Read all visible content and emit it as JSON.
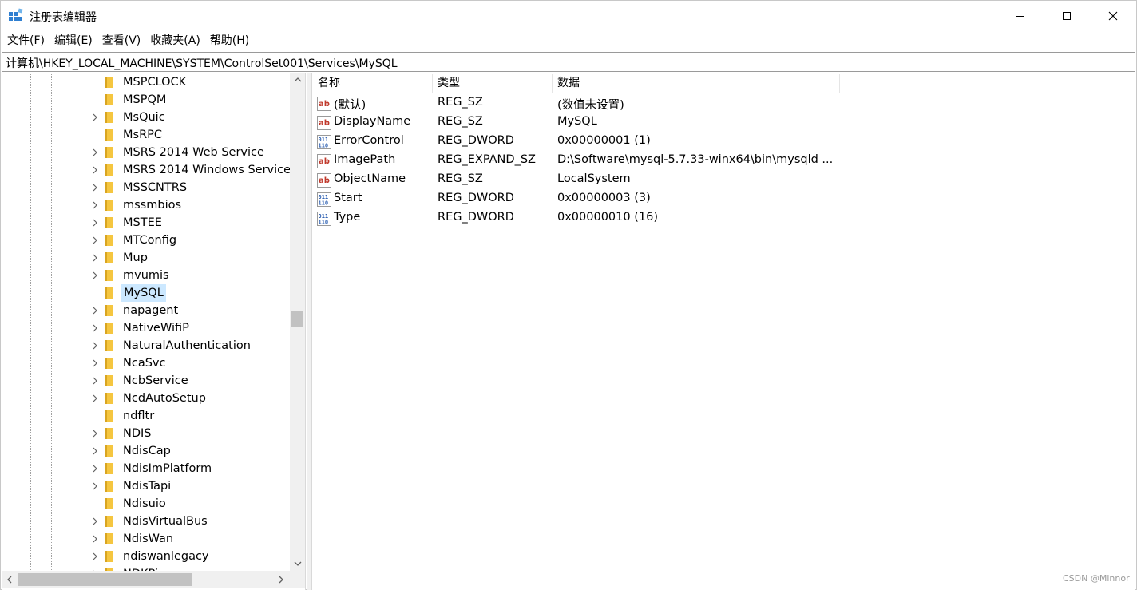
{
  "window": {
    "title": "注册表编辑器"
  },
  "menu": [
    {
      "label": "文件(F)"
    },
    {
      "label": "编辑(E)"
    },
    {
      "label": "查看(V)"
    },
    {
      "label": "收藏夹(A)"
    },
    {
      "label": "帮助(H)"
    }
  ],
  "address": {
    "path": "计算机\\HKEY_LOCAL_MACHINE\\SYSTEM\\ControlSet001\\Services\\MySQL"
  },
  "tree": {
    "items": [
      {
        "label": "MSPCLOCK",
        "expandable": false,
        "selected": false
      },
      {
        "label": "MSPQM",
        "expandable": false,
        "selected": false
      },
      {
        "label": "MsQuic",
        "expandable": true,
        "selected": false
      },
      {
        "label": "MsRPC",
        "expandable": false,
        "selected": false
      },
      {
        "label": "MSRS 2014 Web Service",
        "expandable": true,
        "selected": false
      },
      {
        "label": "MSRS 2014 Windows Service",
        "expandable": true,
        "selected": false
      },
      {
        "label": "MSSCNTRS",
        "expandable": true,
        "selected": false
      },
      {
        "label": "mssmbios",
        "expandable": true,
        "selected": false
      },
      {
        "label": "MSTEE",
        "expandable": true,
        "selected": false
      },
      {
        "label": "MTConfig",
        "expandable": true,
        "selected": false
      },
      {
        "label": "Mup",
        "expandable": true,
        "selected": false
      },
      {
        "label": "mvumis",
        "expandable": true,
        "selected": false
      },
      {
        "label": "MySQL",
        "expandable": false,
        "selected": true
      },
      {
        "label": "napagent",
        "expandable": true,
        "selected": false
      },
      {
        "label": "NativeWifiP",
        "expandable": true,
        "selected": false
      },
      {
        "label": "NaturalAuthentication",
        "expandable": true,
        "selected": false
      },
      {
        "label": "NcaSvc",
        "expandable": true,
        "selected": false
      },
      {
        "label": "NcbService",
        "expandable": true,
        "selected": false
      },
      {
        "label": "NcdAutoSetup",
        "expandable": true,
        "selected": false
      },
      {
        "label": "ndfltr",
        "expandable": false,
        "selected": false
      },
      {
        "label": "NDIS",
        "expandable": true,
        "selected": false
      },
      {
        "label": "NdisCap",
        "expandable": true,
        "selected": false
      },
      {
        "label": "NdisImPlatform",
        "expandable": true,
        "selected": false
      },
      {
        "label": "NdisTapi",
        "expandable": true,
        "selected": false
      },
      {
        "label": "Ndisuio",
        "expandable": false,
        "selected": false
      },
      {
        "label": "NdisVirtualBus",
        "expandable": true,
        "selected": false
      },
      {
        "label": "NdisWan",
        "expandable": true,
        "selected": false
      },
      {
        "label": "ndiswanlegacy",
        "expandable": true,
        "selected": false
      },
      {
        "label": "NDKPing",
        "expandable": true,
        "selected": false
      }
    ]
  },
  "values": {
    "columns": {
      "name": "名称",
      "type": "类型",
      "data": "数据"
    },
    "rows": [
      {
        "icon": "string-value-icon",
        "name": "(默认)",
        "type": "REG_SZ",
        "data": "(数值未设置)"
      },
      {
        "icon": "string-value-icon",
        "name": "DisplayName",
        "type": "REG_SZ",
        "data": "MySQL"
      },
      {
        "icon": "binary-value-icon",
        "name": "ErrorControl",
        "type": "REG_DWORD",
        "data": "0x00000001 (1)"
      },
      {
        "icon": "string-value-icon",
        "name": "ImagePath",
        "type": "REG_EXPAND_SZ",
        "data": "D:\\Software\\mysql-5.7.33-winx64\\bin\\mysqld ..."
      },
      {
        "icon": "string-value-icon",
        "name": "ObjectName",
        "type": "REG_SZ",
        "data": "LocalSystem"
      },
      {
        "icon": "binary-value-icon",
        "name": "Start",
        "type": "REG_DWORD",
        "data": "0x00000003 (3)"
      },
      {
        "icon": "binary-value-icon",
        "name": "Type",
        "type": "REG_DWORD",
        "data": "0x00000010 (16)"
      }
    ]
  },
  "watermark": "CSDN @Minnor",
  "colors": {
    "selection": "#cce8ff",
    "folder": "#f5c640",
    "string_icon": "#c0392b",
    "binary_icon": "#2a5db0"
  }
}
